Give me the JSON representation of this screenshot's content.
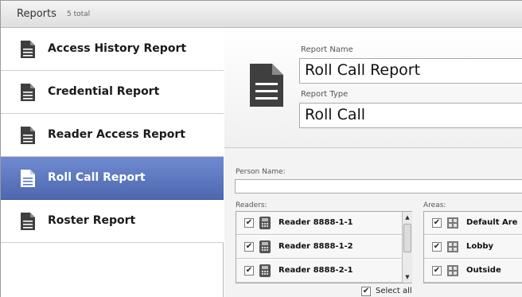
{
  "titlebar": {
    "title": "Reports",
    "count": "5 total"
  },
  "sidebar": {
    "items": [
      {
        "label": "Access History Report",
        "selected": false
      },
      {
        "label": "Credential Report",
        "selected": false
      },
      {
        "label": "Reader Access Report",
        "selected": false
      },
      {
        "label": "Roll Call Report",
        "selected": true
      },
      {
        "label": "Roster Report",
        "selected": false
      }
    ]
  },
  "details": {
    "report_name_label": "Report Name",
    "report_name": "Roll Call Report",
    "report_type_label": "Report Type",
    "report_type": "Roll Call"
  },
  "filters": {
    "person_name_label": "Person Name:",
    "person_name_value": "",
    "readers_label": "Readers:",
    "readers": [
      {
        "name": "Reader 8888-1-1",
        "checked": "✔"
      },
      {
        "name": "Reader 8888-1-2",
        "checked": "✔"
      },
      {
        "name": "Reader 8888-2-1",
        "checked": "✔"
      }
    ],
    "areas_label": "Areas:",
    "areas": [
      {
        "name": "Default Are",
        "checked": "✔"
      },
      {
        "name": "Lobby",
        "checked": "✔"
      },
      {
        "name": "Outside",
        "checked": "✔"
      }
    ],
    "select_all_label": "Select all",
    "select_all_checked": "✔"
  },
  "icons": {
    "document": "document-icon",
    "reader": "card-reader-icon",
    "area": "area-grid-icon",
    "scroll_up": "▲",
    "scroll_down": "▼"
  },
  "colors": {
    "selection": "#5b74bf",
    "header_bg": "#dedede",
    "doc_icon": "#3f3f3f"
  }
}
